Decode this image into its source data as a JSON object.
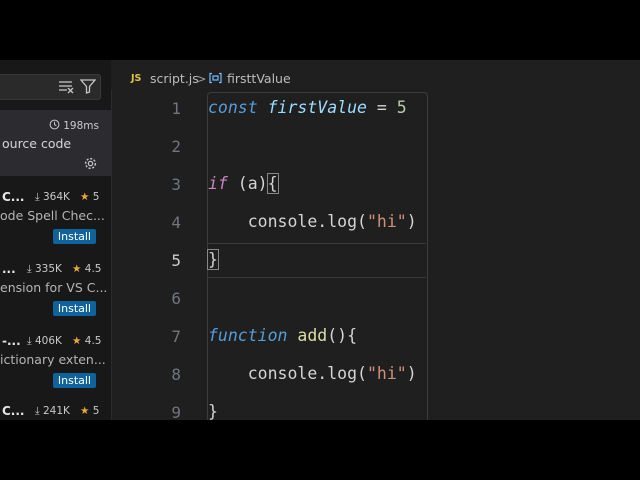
{
  "sidebar": {
    "results_time": "198ms",
    "selected_desc": "ource code",
    "extensions": [
      {
        "name": "C...",
        "downloads": "364K",
        "rating": "5",
        "desc": "ode Spell Chec...",
        "install_label": "Install"
      },
      {
        "name": "...",
        "downloads": "335K",
        "rating": "4.5",
        "desc": "ension for VS C...",
        "install_label": "Install"
      },
      {
        "name": "-...",
        "downloads": "406K",
        "rating": "4.5",
        "desc": "ictionary exten...",
        "install_label": "Install"
      },
      {
        "name": "C...",
        "downloads": "241K",
        "rating": "5",
        "desc": "",
        "install_label": ""
      }
    ]
  },
  "breadcrumb": {
    "file_icon": "JS",
    "file": "script.js",
    "separator": ">",
    "symbol": "firsttValue"
  },
  "editor": {
    "line_numbers": [
      "1",
      "2",
      "3",
      "4",
      "5",
      "6",
      "7",
      "8",
      "9"
    ],
    "active_line": "5",
    "lines": {
      "l1_kw": "const",
      "l1_var": "firstValue",
      "l1_op": " = ",
      "l1_num": "5",
      "l3_kw": "if",
      "l3_rest": " (a)",
      "l3_brace": "{",
      "l4_indent": "    ",
      "l4_obj": "console.",
      "l4_fn": "log",
      "l4_open": "(",
      "l4_str": "\"hi\"",
      "l4_close": ")",
      "l5_brace": "}",
      "l7_kw": "function",
      "l7_fn": " add",
      "l7_rest": "(){",
      "l8_indent": "    ",
      "l8_obj": "console.",
      "l8_fn": "log",
      "l8_open": "(",
      "l8_str": "\"hi\"",
      "l8_close": ")",
      "l9_brace": "}"
    }
  },
  "colors": {
    "background": "#1f1f1f",
    "sidebar": "#181818",
    "install_button": "#0e639c",
    "keyword": "#c586c0",
    "string": "#ce9178"
  }
}
